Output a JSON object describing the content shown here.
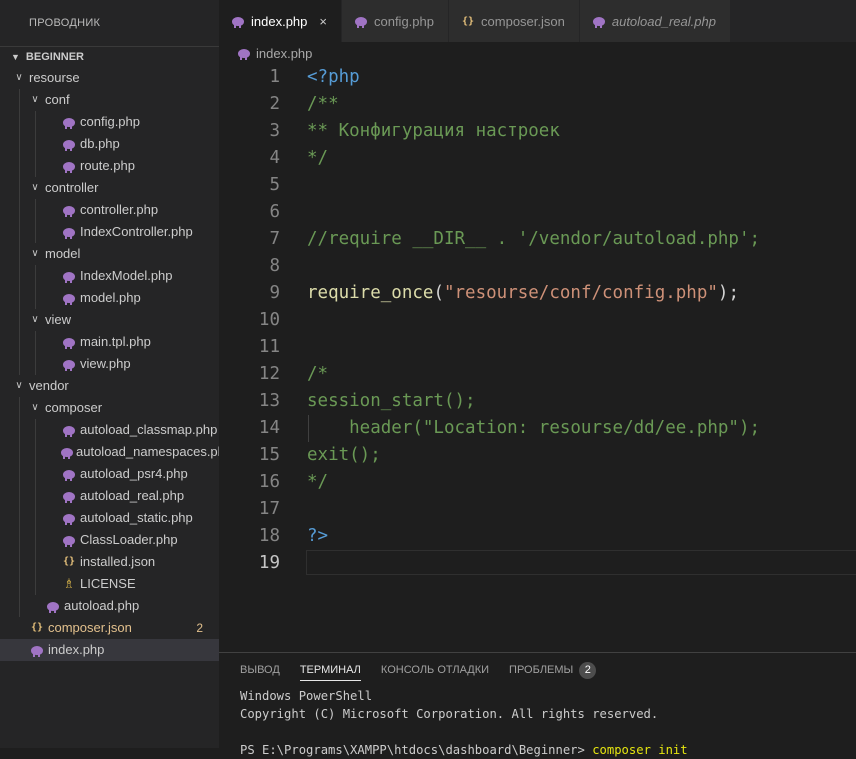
{
  "explorer": {
    "title": "ПРОВОДНИК",
    "root": "BEGINNER",
    "items": [
      {
        "label": "resourse",
        "type": "folder",
        "depth": 0
      },
      {
        "label": "conf",
        "type": "folder",
        "depth": 1
      },
      {
        "label": "config.php",
        "type": "php",
        "depth": 2
      },
      {
        "label": "db.php",
        "type": "php",
        "depth": 2
      },
      {
        "label": "route.php",
        "type": "php",
        "depth": 2
      },
      {
        "label": "controller",
        "type": "folder",
        "depth": 1
      },
      {
        "label": "controller.php",
        "type": "php",
        "depth": 2
      },
      {
        "label": "IndexController.php",
        "type": "php",
        "depth": 2
      },
      {
        "label": "model",
        "type": "folder",
        "depth": 1
      },
      {
        "label": "IndexModel.php",
        "type": "php",
        "depth": 2
      },
      {
        "label": "model.php",
        "type": "php",
        "depth": 2
      },
      {
        "label": "view",
        "type": "folder",
        "depth": 1
      },
      {
        "label": "main.tpl.php",
        "type": "php",
        "depth": 2
      },
      {
        "label": "view.php",
        "type": "php",
        "depth": 2
      },
      {
        "label": "vendor",
        "type": "folder",
        "depth": 0
      },
      {
        "label": "composer",
        "type": "folder",
        "depth": 1
      },
      {
        "label": "autoload_classmap.php",
        "type": "php",
        "depth": 2
      },
      {
        "label": "autoload_namespaces.php",
        "type": "php",
        "depth": 2
      },
      {
        "label": "autoload_psr4.php",
        "type": "php",
        "depth": 2
      },
      {
        "label": "autoload_real.php",
        "type": "php",
        "depth": 2
      },
      {
        "label": "autoload_static.php",
        "type": "php",
        "depth": 2
      },
      {
        "label": "ClassLoader.php",
        "type": "php",
        "depth": 2
      },
      {
        "label": "installed.json",
        "type": "json",
        "depth": 2
      },
      {
        "label": "LICENSE",
        "type": "license",
        "depth": 2
      },
      {
        "label": "autoload.php",
        "type": "php",
        "depth": 1
      },
      {
        "label": "composer.json",
        "type": "json",
        "depth": 0,
        "modified": true,
        "badge": "2"
      },
      {
        "label": "index.php",
        "type": "php",
        "depth": 0,
        "selected": true
      }
    ]
  },
  "tabs": [
    {
      "label": "index.php",
      "type": "php",
      "active": true,
      "close": "×"
    },
    {
      "label": "config.php",
      "type": "php"
    },
    {
      "label": "composer.json",
      "type": "json"
    },
    {
      "label": "autoload_real.php",
      "type": "php",
      "italic": true
    }
  ],
  "breadcrumb": {
    "file": "index.php"
  },
  "code": [
    {
      "n": "1",
      "tokens": [
        [
          "kw",
          "<?php"
        ]
      ]
    },
    {
      "n": "2",
      "tokens": [
        [
          "cm",
          "/**"
        ]
      ]
    },
    {
      "n": "3",
      "tokens": [
        [
          "cm",
          "** Конфигурация настроек"
        ]
      ]
    },
    {
      "n": "4",
      "tokens": [
        [
          "cm",
          "*/"
        ]
      ]
    },
    {
      "n": "5",
      "tokens": []
    },
    {
      "n": "6",
      "tokens": []
    },
    {
      "n": "7",
      "tokens": [
        [
          "cm",
          "//require __DIR__ . '/vendor/autoload.php';"
        ]
      ]
    },
    {
      "n": "8",
      "tokens": []
    },
    {
      "n": "9",
      "tokens": [
        [
          "fn",
          "require_once"
        ],
        [
          "pl",
          "("
        ],
        [
          "st",
          "\"resourse/conf/config.php\""
        ],
        [
          "pl",
          ");"
        ]
      ]
    },
    {
      "n": "10",
      "tokens": []
    },
    {
      "n": "11",
      "tokens": []
    },
    {
      "n": "12",
      "tokens": [
        [
          "cm",
          "/*"
        ]
      ]
    },
    {
      "n": "13",
      "tokens": [
        [
          "cm",
          "session_start();"
        ]
      ]
    },
    {
      "n": "14",
      "tokens": [
        [
          "cm",
          "    header(\"Location: resourse/dd/ee.php\");"
        ]
      ],
      "guide": true
    },
    {
      "n": "15",
      "tokens": [
        [
          "cm",
          "exit();"
        ]
      ]
    },
    {
      "n": "16",
      "tokens": [
        [
          "cm",
          "*/"
        ]
      ]
    },
    {
      "n": "17",
      "tokens": []
    },
    {
      "n": "18",
      "tokens": [
        [
          "kw",
          "?>"
        ]
      ]
    },
    {
      "n": "19",
      "tokens": [],
      "current": true
    }
  ],
  "panel": {
    "tabs": [
      {
        "label": "ВЫВОД"
      },
      {
        "label": "ТЕРМИНАЛ",
        "active": true
      },
      {
        "label": "КОНСОЛЬ ОТЛАДКИ"
      },
      {
        "label": "ПРОБЛЕМЫ",
        "count": "2"
      }
    ],
    "terminal": [
      {
        "text": "Windows PowerShell"
      },
      {
        "text": "Copyright (C) Microsoft Corporation. All rights reserved."
      },
      {
        "text": ""
      },
      {
        "prompt": "PS E:\\Programs\\XAMPP\\htdocs\\dashboard\\Beginner> ",
        "cmd": "composer init"
      }
    ]
  }
}
